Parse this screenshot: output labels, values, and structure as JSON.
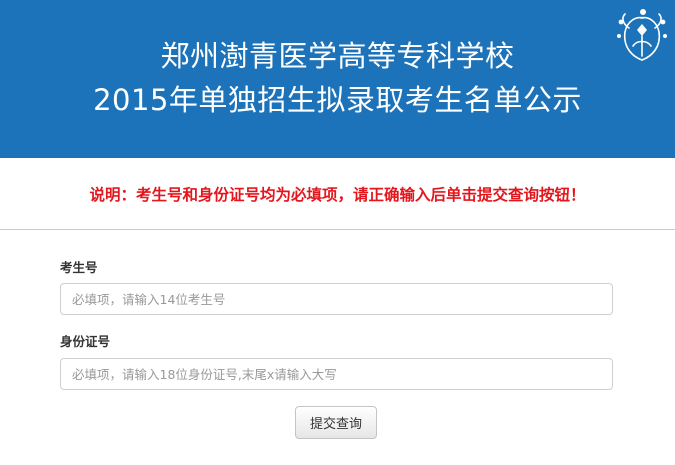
{
  "header": {
    "title_line1": "郑州澍青医学高等专科学校",
    "title_line2": "2015年单独招生拟录取考生名单公示",
    "background_color": "#1c73b9",
    "logo_icon": "floral-emblem-icon"
  },
  "notice": {
    "text": "说明：考生号和身份证号均为必填项，请正确输入后单击提交查询按钮！",
    "color": "#e4161d"
  },
  "form": {
    "exam_number": {
      "label": "考生号",
      "placeholder": "必填项，请输入14位考生号",
      "value": ""
    },
    "id_number": {
      "label": "身份证号",
      "placeholder": "必填项，请输入18位身份证号,末尾x请输入大写",
      "value": ""
    },
    "submit_label": "提交查询"
  }
}
